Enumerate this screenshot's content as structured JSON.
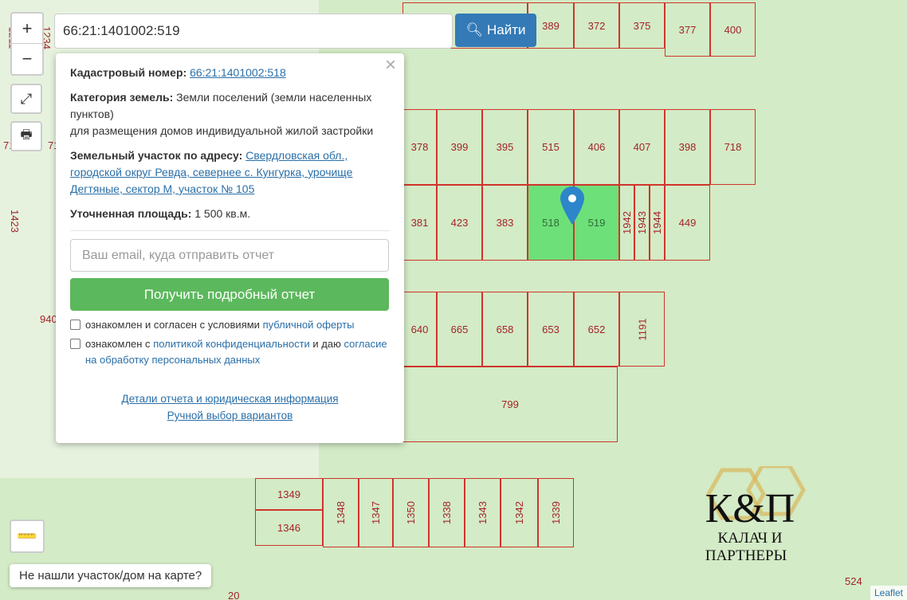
{
  "search": {
    "value": "66:21:1401002:519",
    "button": "Найти"
  },
  "controls": {
    "zoom_in": "+",
    "zoom_out": "−"
  },
  "popup": {
    "cad_label": "Кадастровый номер:",
    "cad_value": "66:21:1401002:518",
    "cat_label": "Категория земель:",
    "cat_value": "Земли поселений (земли населенных пунктов)",
    "cat_use": "для размещения домов индивидуальной жилой застройки",
    "addr_label": "Земельный участок по адресу:",
    "addr_value": "Свердловская обл., городской округ Ревда, севернее с. Кунгурка, урочище Дегтяные, сектор М, участок № 105",
    "area_label": "Уточненная площадь:",
    "area_value": "1 500 кв.м.",
    "email_placeholder": "Ваш email, куда отправить отчет",
    "get_report": "Получить подробный отчет",
    "chk1_text": "ознакомлен и согласен с условиями ",
    "chk1_link": "публичной оферты",
    "chk2_text": "ознакомлен с ",
    "chk2_link": "политикой конфиденциальности",
    "chk2_text2": " и даю ",
    "chk2_link2": "согласие на обработку персональных данных",
    "link_details": "Детали отчета и юридическая информация",
    "link_manual": "Ручной выбор вариантов"
  },
  "parcels": [
    "389",
    "372",
    "375",
    "377",
    "400",
    "378",
    "399",
    "395",
    "515",
    "406",
    "407",
    "398",
    "718",
    "381",
    "423",
    "383",
    "518",
    "519",
    "1942",
    "1943",
    "1944",
    "449",
    "640",
    "665",
    "658",
    "653",
    "652",
    "1191",
    "799",
    "1349",
    "1346",
    "1348",
    "1347",
    "1350",
    "1338",
    "1343",
    "1342",
    "1339"
  ],
  "labels": [
    "1211",
    "1234",
    "71",
    "71",
    "1423",
    "940",
    "524",
    "20"
  ],
  "not_found": "Не нашли участок/дом на карте?",
  "attribution": "Leaflet",
  "logo": {
    "mark": "К&П",
    "name": "КАЛАЧ И ПАРТНЕРЫ"
  },
  "colors": {
    "parcel_border": "#d0342c",
    "selected": "#6ee07a",
    "button_blue": "#337ab7",
    "button_green": "#5cb85c"
  }
}
